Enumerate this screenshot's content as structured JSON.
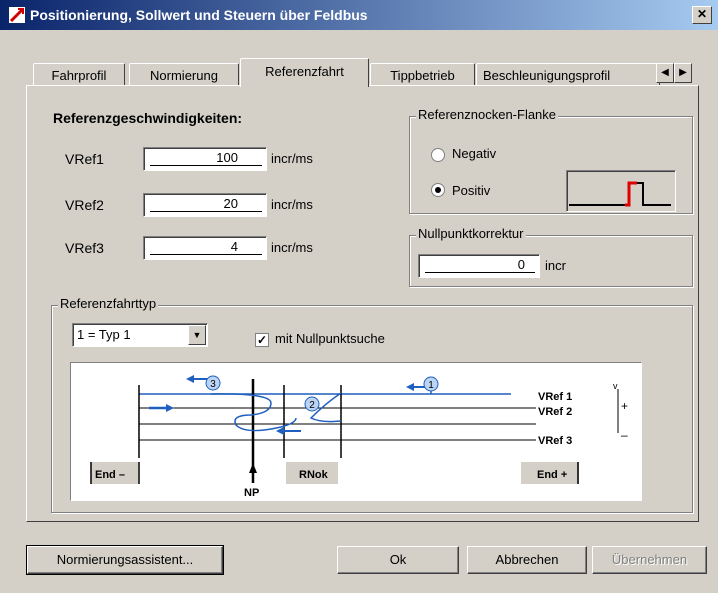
{
  "window": {
    "title": "Positionierung, Sollwert und Steuern über Feldbus",
    "close": "✕"
  },
  "tabs": [
    {
      "label": "Fahrprofil",
      "active": false
    },
    {
      "label": "Normierung",
      "active": false
    },
    {
      "label": "Referenzfahrt",
      "active": true
    },
    {
      "label": "Tippbetrieb",
      "active": false
    },
    {
      "label": "Beschleunigungsprofil",
      "active": false
    }
  ],
  "tab_scroll": {
    "left": "◀",
    "right": "▶"
  },
  "ref_speeds": {
    "heading": "Referenzgeschwindigkeiten:",
    "rows": [
      {
        "label": "VRef1",
        "value": "100",
        "unit": "incr/ms"
      },
      {
        "label": "VRef2",
        "value": "20",
        "unit": "incr/ms"
      },
      {
        "label": "VRef3",
        "value": "4",
        "unit": "incr/ms"
      }
    ]
  },
  "cam_edge": {
    "title": "Referenznocken-Flanke",
    "options": [
      {
        "label": "Negativ",
        "selected": false
      },
      {
        "label": "Positiv",
        "selected": true
      }
    ]
  },
  "zero_correction": {
    "title": "Nullpunktkorrektur",
    "value": "0",
    "unit": "incr"
  },
  "ref_type": {
    "title": "Referenzfahrttyp",
    "selected": "1 = Typ 1",
    "checkbox_label": "mit Nullpunktsuche",
    "checked": true
  },
  "diagram": {
    "markers": [
      "1",
      "2",
      "3"
    ],
    "speed_labels": [
      "VRef 1",
      "VRef 2",
      "VRef 3"
    ],
    "axis_v": "v",
    "axis_plus": "+",
    "axis_minus": "–",
    "labels": {
      "end_minus": "End –",
      "rnok": "RNok",
      "end_plus": "End +",
      "np": "NP"
    }
  },
  "buttons": {
    "assistant": "Normierungsassistent...",
    "ok": "Ok",
    "cancel": "Abbrechen",
    "apply": "Übernehmen"
  },
  "colors": {
    "accent": "#1f5fbf",
    "cam_red": "#e00000"
  }
}
